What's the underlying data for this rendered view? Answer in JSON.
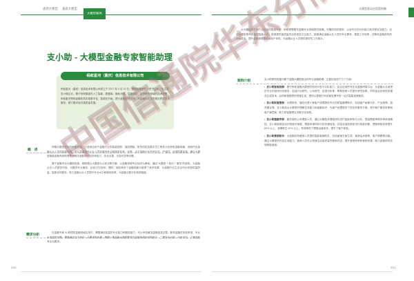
{
  "header": {
    "left_tabs": [
      "通用大模型",
      "垂类大模型",
      "大模型服务"
    ],
    "right_title": "大模型驱动应用案例集"
  },
  "left_page": {
    "title": "支小助 - 大模型金融专家智能助理",
    "company": {
      "name": "蚂蚁星河（重庆）信息技术有限公司",
      "description": "蚂蚁星河（重庆）信息技术有限公司成立于 2017 年 4 月 19 日，是蚂蚁集团的全资子公司，专注服务小微企业。基于蚂蚁集团在人工智能、数据库、隐私计算、智能风控、区块链等领域的技术积累，蚂蚁星河帮助金融机构实现数字化、智能化升级，提升金融服务效率，为金融行业提供更优质的技术服务，助力数字经济高质量发展。"
    },
    "sections": [
      {
        "label": "概　述",
        "paragraphs": [
          "伴随大模型技术的快速发展，已逐渐应用于金融行业的智能投顾、保险理赔、研究风控及数字员工等多元化典型金融场景。然而作为金融从业人员的智能助理，可以显著提升从业人员的服务专业和服务效率。但是，由于金融行业的专业性、严谨性、合规性要求高，通过大模型赋能金融专家助理需要解决金融领域知识和能力、安全合规、可信可控等问题。",
          "基于金融专业大模型底座，助助理以大模型为认知决策引擎，以金融领域专业知识为基础，通过“大模型 + 知识 + 服务”的架构，为金融从业人员提供可信、可靠的专业服务。目前已在投研、理财、保险等多个金融场景中取得了良好效果，为金融行业生态合作伙伴提供高质量、智能化的服务，助力金融从业人员提升专业水平和服务效率，为金融业数字化转型赋能。"
        ]
      },
      {
        "label": "需求分析",
        "paragraphs": [
          "在金融专家 AI 助理的金融领域应用中，需要满足较高的专业能力和服务能力，可以有效解决金融信息过载、服务金融任务效率低、专业水准高的问题。需要满足如下条件：从需求侧来看，需要一是金融大模型要求在金融领域知识和能力，二是安全合规、可信可控，三是金融专业化要求。"
        ]
      }
    ],
    "page_number": "200"
  },
  "right_page": {
    "intro": "从大模型的金融行业应用的角度来看，助助理需要在金融专业领域提供准确、可靠的知识服务，以及专业的分析能力和决策支持能力。目前大模型具有较高的智能水平，能够提供高质量的自然语言交互能力，能够满足金融从业人员的专业需求，提高工作效率，并降低金融机构的运营成本，提升金融服务质量和用户体验，为金融从业人员提供更好的工作助手。",
    "section_label": "案例介绍",
    "section_intro": "支小助是蚂蚁星河基于金融大模型推出的专业金融助理，主要包括如下几个方面：",
    "bullets": [
      {
        "title": "支小助智能投顾：",
        "text": "基于蚂蚁金融大模型的知识问答与分析能力，结合自身的专业化金融研报平台，为金融从业者提供专业的投研分析服务，包括行业研究、公司研究、宏观分析等，帮助投研人员提升研究效率。同时结合自研的多模态生成技术，实现研报图表的快速生成，提供从数据分析到报告撰写的一站式智能投研服务。"
      },
      {
        "title": "支小助财富管家：",
        "text": "为理财师、保险代理人等客户经理提供专业的财富管理助手，包括客户画像分析、产品推荐、投资建议等。支小助结合大模型的理解生成能力和金融知识，为客户经理提供个性化的服务方案，提升客户服务效率和客户满意度，助力财富管理业务数字化转型。"
      },
      {
        "title": "支小助理赔专家：",
        "text": "服务保险公司理赔人员，通过大模型对理赔材料进行智能审核与分析，提高理赔审核效率和准确性。支小助能够自动识别医疗单据、理赔申请材料中的关键信息，并结合保险条款进行智能判断，理赔审核效率提升 80% 以上，准确率达 90% 以上，有效降低了理赔运营成本，提升了客户体验。"
      },
      {
        "title": "支小助营销助手：",
        "text": "为金融机构营销人员提供智能营销助手，包括营销文案生成、营销话术推荐、客户洞察等功能。通过大模型的内容生成能力，营销人员可以快速生成高质量的营销内容，提升营销效率和营销效果，助力金融机构实现精准营销。"
      }
    ],
    "page_number": "201"
  },
  "watermark": {
    "text": "中国信通院华东分院",
    "color": "#888888"
  },
  "colors": {
    "accent": "#2a8a3d",
    "card_bg": "#e8f1e0"
  }
}
